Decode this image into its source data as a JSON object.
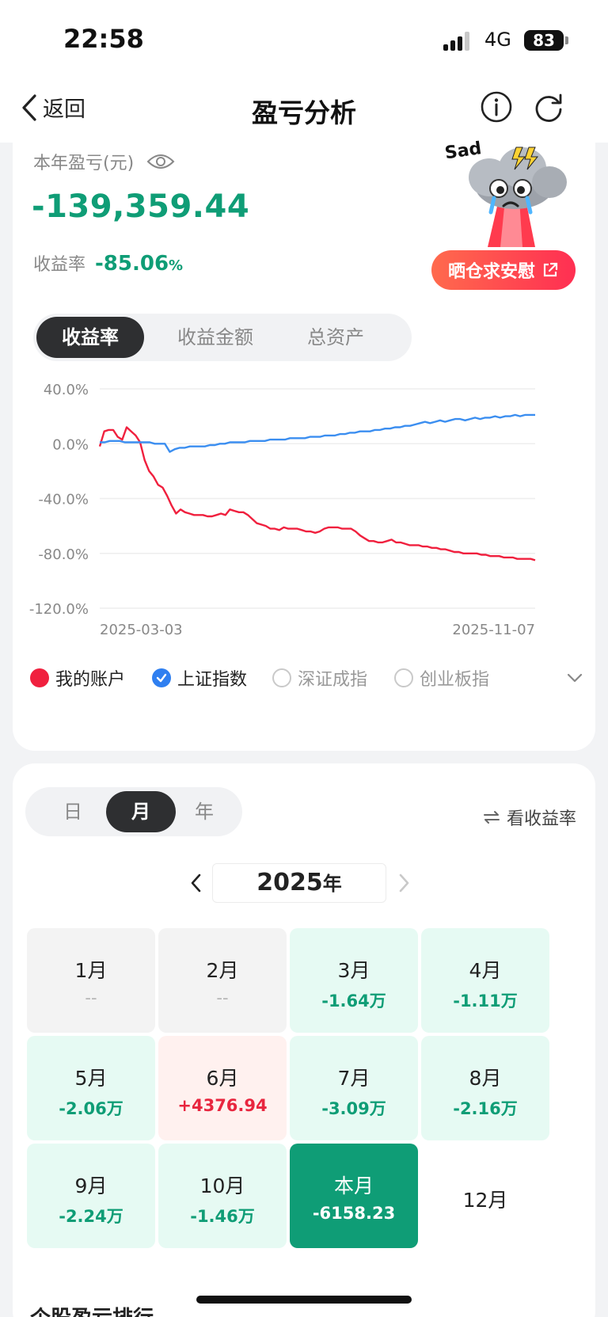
{
  "status_bar": {
    "time": "22:58",
    "network": "4G",
    "battery": "83"
  },
  "nav": {
    "back_label": "返回",
    "title": "盈亏分析"
  },
  "summary": {
    "profit_label": "本年盈亏(元)",
    "profit_value": "-139,359.44",
    "rate_label": "收益率",
    "rate_value": "-85.06",
    "rate_unit": "%",
    "mascot_text": "Sad",
    "share_label": "晒仓求安慰"
  },
  "chart_tabs": {
    "items": [
      "收益率",
      "收益金额",
      "总资产"
    ],
    "active": 0
  },
  "chart_data": {
    "type": "line",
    "ylim": [
      -120,
      40
    ],
    "yticks": [
      "40.0%",
      "0.0%",
      "-40.0%",
      "-80.0%",
      "-120.0%"
    ],
    "ytick_values": [
      40,
      0,
      -40,
      -80,
      -120
    ],
    "xtick_labels": [
      "2025-03-03",
      "2025-11-07"
    ],
    "grid": true,
    "series": [
      {
        "name": "我的账户",
        "color": "#f0203e",
        "values": [
          -2,
          9,
          10,
          10,
          5,
          3,
          12,
          9,
          6,
          1,
          -12,
          -20,
          -24,
          -30,
          -32,
          -38,
          -45,
          -51,
          -48,
          -50,
          -51,
          -52,
          -52,
          -52,
          -53,
          -53,
          -52,
          -51,
          -52,
          -48,
          -49,
          -50,
          -50,
          -52,
          -55,
          -58,
          -59,
          -60,
          -62,
          -62,
          -63,
          -61,
          -62,
          -62,
          -62,
          -63,
          -64,
          -64,
          -65,
          -64,
          -62,
          -61,
          -61,
          -61,
          -62,
          -62,
          -62,
          -64,
          -67,
          -69,
          -71,
          -71,
          -72,
          -72,
          -71,
          -70,
          -72,
          -72,
          -73,
          -74,
          -74,
          -74,
          -75,
          -75,
          -76,
          -76,
          -77,
          -77,
          -78,
          -79,
          -79,
          -80,
          -80,
          -80,
          -80,
          -81,
          -81,
          -82,
          -82,
          -82,
          -83,
          -83,
          -83,
          -84,
          -84,
          -84,
          -84,
          -85
        ]
      },
      {
        "name": "上证指数",
        "color": "#3b8ef0",
        "values": [
          1,
          1,
          2,
          2,
          2,
          1,
          1,
          1,
          1,
          1,
          1,
          0,
          0,
          0,
          -6,
          -4,
          -3,
          -3,
          -2,
          -2,
          -2,
          -2,
          -1,
          -1,
          0,
          0,
          1,
          1,
          1,
          1,
          2,
          2,
          2,
          2,
          3,
          3,
          3,
          3,
          4,
          4,
          4,
          4,
          5,
          5,
          5,
          6,
          6,
          6,
          7,
          7,
          8,
          8,
          9,
          9,
          9,
          10,
          10,
          11,
          11,
          12,
          12,
          13,
          13,
          14,
          15,
          16,
          15,
          16,
          17,
          16,
          17,
          18,
          18,
          17,
          18,
          19,
          18,
          19,
          19,
          20,
          19,
          20,
          20,
          21,
          20,
          21,
          21,
          21
        ]
      }
    ],
    "legend_inactive": [
      "深证成指",
      "创业板指"
    ]
  },
  "calendar": {
    "period_tabs": [
      "日",
      "月",
      "年"
    ],
    "period_active": 1,
    "switch_label": "看收益率",
    "year_num": "2025",
    "year_unit": "年",
    "months": [
      {
        "month": "1月",
        "value": "--",
        "state": "gray"
      },
      {
        "month": "2月",
        "value": "--",
        "state": "gray"
      },
      {
        "month": "3月",
        "value": "-1.64万",
        "state": "green"
      },
      {
        "month": "4月",
        "value": "-1.11万",
        "state": "green"
      },
      {
        "month": "5月",
        "value": "-2.06万",
        "state": "green"
      },
      {
        "month": "6月",
        "value": "+4376.94",
        "state": "red"
      },
      {
        "month": "7月",
        "value": "-3.09万",
        "state": "green"
      },
      {
        "month": "8月",
        "value": "-2.16万",
        "state": "green"
      },
      {
        "month": "9月",
        "value": "-2.24万",
        "state": "green"
      },
      {
        "month": "10月",
        "value": "-1.46万",
        "state": "green"
      },
      {
        "month": "本月",
        "value": "-6158.23",
        "state": "current"
      },
      {
        "month": "12月",
        "value": "",
        "state": "plain"
      }
    ]
  },
  "bottom": {
    "section_title": "个股盈亏排行"
  }
}
